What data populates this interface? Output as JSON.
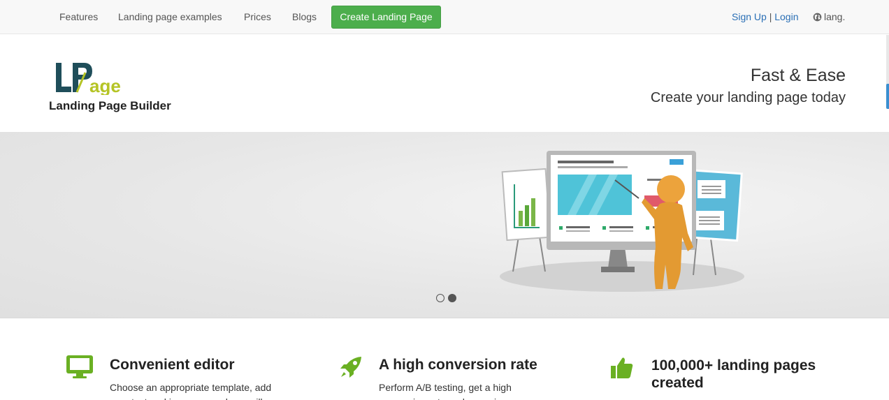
{
  "nav": {
    "items": [
      {
        "label": "Features"
      },
      {
        "label": "Landing page examples"
      },
      {
        "label": "Prices"
      },
      {
        "label": "Blogs"
      }
    ],
    "cta_label": "Create Landing Page",
    "signup_label": "Sign Up",
    "separator": "|",
    "login_label": "Login",
    "lang_label": "lang."
  },
  "header": {
    "logo_text": "LPage",
    "logo_subtitle": "Landing Page Builder",
    "title": "Fast & Ease",
    "subtitle": "Create your landing page today"
  },
  "carousel": {
    "slide_count": 2,
    "active_index": 1
  },
  "features": [
    {
      "title": "Convenient editor",
      "text": "Choose an appropriate template, add your text and images... and you will",
      "icon": "monitor-icon"
    },
    {
      "title": "A high conversion rate",
      "text": "Perform A/B testing, get a high conversion rate and a maximum",
      "icon": "rocket-icon"
    },
    {
      "title": "100,000+ landing pages",
      "title_line2": "created",
      "text": "",
      "icon": "thumbs-up-icon"
    }
  ],
  "colors": {
    "accent_green": "#5cb85c",
    "icon_green": "#6ab023",
    "link_blue": "#2a6fb5",
    "logo_dark": "#1f4e5a",
    "logo_lime": "#b5c425"
  }
}
